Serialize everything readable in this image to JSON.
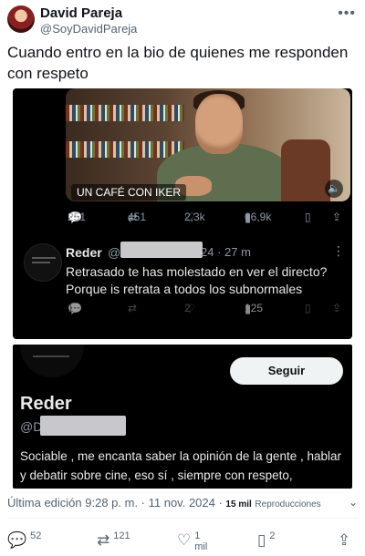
{
  "author": {
    "name": "David Pareja",
    "handle": "@SoyDavidPareja",
    "more": "•••"
  },
  "tweet": {
    "text": "Cuando entro en la bio de quienes me responden con respeto"
  },
  "screenshot1": {
    "video_label": "UN CAFÉ CON IKER",
    "metrics": {
      "replies": "251",
      "reposts": "451",
      "likes": "2,3k",
      "views": "66,9k"
    },
    "reply": {
      "name": "Reder",
      "handle_prefix": "@",
      "time": "24 · 27 m",
      "more": "⋮",
      "text": "Retrasado te has molestado en ver el directo? Porque is retrata a todos los subnormales",
      "metrics": {
        "replies": "1",
        "likes": "2",
        "views": "125"
      }
    }
  },
  "screenshot2": {
    "follow_label": "Seguir",
    "name": "Reder",
    "handle_prefix": "@D",
    "bio": "Sociable , me encanta saber la opinión de la gente , hablar y debatir sobre cine, eso sí , siempre con respeto,"
  },
  "footer": {
    "edited_text": "Última edición 9:28 p. m. · 11 nov. 2024 · ",
    "views_count": "15 mil",
    "views_label": "Reproducciones",
    "actions": {
      "replies": "52",
      "reposts": "121",
      "likes": "1 mil",
      "bookmarks": "2"
    }
  }
}
